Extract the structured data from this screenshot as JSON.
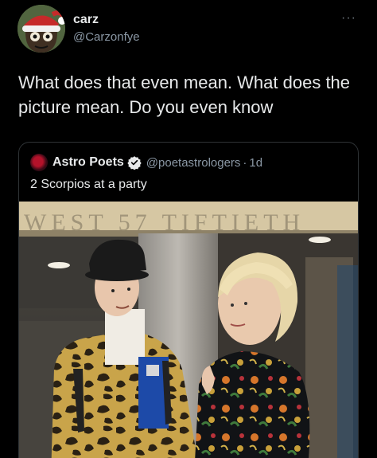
{
  "tweet": {
    "display_name": "carz",
    "handle": "@Carzonfye",
    "text": "What does that even mean. What does the picture mean. Do you even know",
    "more_label": "···"
  },
  "quote": {
    "display_name": "Astro Poets",
    "handle": "@poetastrologers",
    "separator": "·",
    "time": "1d",
    "text": "2 Scorpios at a party",
    "sign_text": "WEST 57 TIFTIETH"
  },
  "colors": {
    "background": "#000000",
    "text_primary": "#e7e9ea",
    "text_secondary": "#8b98a5",
    "verified": "#1d9bf0",
    "border": "#2f3336"
  },
  "icons": {
    "more": "more-options-icon",
    "verified": "verified-badge-icon"
  }
}
